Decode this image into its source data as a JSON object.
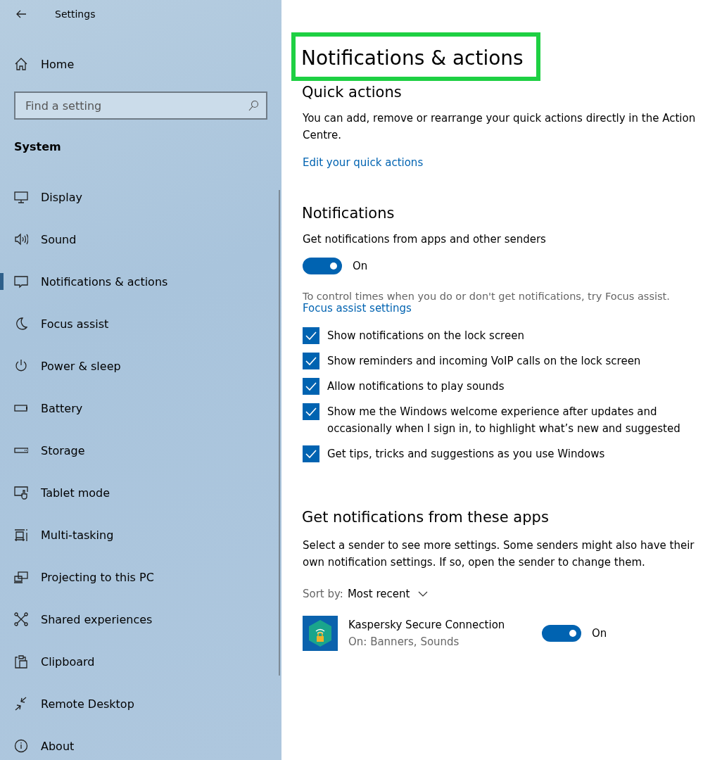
{
  "window": {
    "title": "Settings"
  },
  "sidebar": {
    "home": "Home",
    "search": {
      "placeholder": "Find a setting"
    },
    "section": "System",
    "items": [
      {
        "label": "Display",
        "selected": false
      },
      {
        "label": "Sound",
        "selected": false
      },
      {
        "label": "Notifications & actions",
        "selected": true
      },
      {
        "label": "Focus assist",
        "selected": false
      },
      {
        "label": "Power & sleep",
        "selected": false
      },
      {
        "label": "Battery",
        "selected": false
      },
      {
        "label": "Storage",
        "selected": false
      },
      {
        "label": "Tablet mode",
        "selected": false
      },
      {
        "label": "Multi-tasking",
        "selected": false
      },
      {
        "label": "Projecting to this PC",
        "selected": false
      },
      {
        "label": "Shared experiences",
        "selected": false
      },
      {
        "label": "Clipboard",
        "selected": false
      },
      {
        "label": "Remote Desktop",
        "selected": false
      },
      {
        "label": "About",
        "selected": false
      }
    ]
  },
  "page": {
    "title": "Notifications & actions",
    "quick_actions": {
      "heading": "Quick actions",
      "text": "You can add, remove or rearrange your quick actions directly in the Action Centre.",
      "link": "Edit your quick actions"
    },
    "notifications": {
      "heading": "Notifications",
      "toggle": {
        "label": "Get notifications from apps and other senders",
        "on": true,
        "state": "On"
      },
      "hint": "To control times when you do or don't get notifications, try Focus assist.",
      "link": "Focus assist settings",
      "options": [
        {
          "label": "Show notifications on the lock screen",
          "checked": true
        },
        {
          "label": "Show reminders and incoming VoIP calls on the lock screen",
          "checked": true
        },
        {
          "label": "Allow notifications to play sounds",
          "checked": true
        },
        {
          "label": "Show me the Windows welcome experience after updates and occasionally when I sign in, to highlight what’s new and suggested",
          "checked": true
        },
        {
          "label": "Get tips, tricks and suggestions as you use Windows",
          "checked": true
        }
      ]
    },
    "apps": {
      "heading": "Get notifications from these apps",
      "text": "Select a sender to see more settings. Some senders might also have their own notification settings. If so, open the sender to change them.",
      "sort_label": "Sort by:",
      "sort_value": "Most recent",
      "items": [
        {
          "name": "Kaspersky Secure Connection",
          "detail": "On: Banners, Sounds",
          "on": true,
          "state": "On"
        }
      ]
    }
  }
}
